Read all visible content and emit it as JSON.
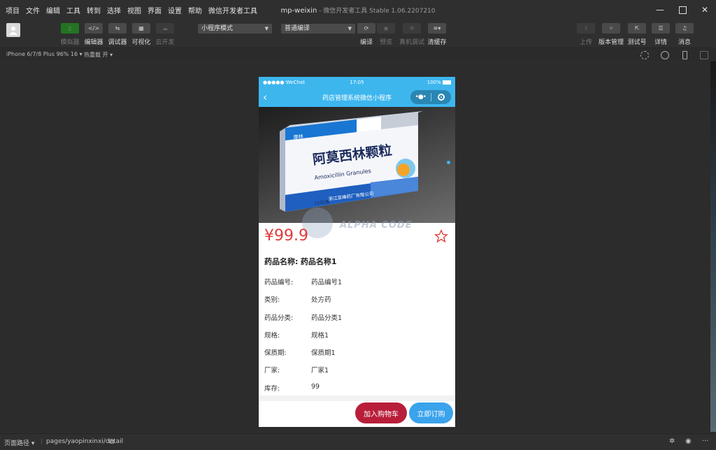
{
  "menubar": {
    "items": [
      "项目",
      "文件",
      "编辑",
      "工具",
      "转到",
      "选择",
      "视图",
      "界面",
      "设置",
      "帮助",
      "微信开发者工具"
    ],
    "title_project": "mp-weixin",
    "title_app": " - 微信开发者工具 Stable 1.06.2207210"
  },
  "toolbar": {
    "simulator_label": "模拟器",
    "editor_label": "编辑器",
    "debugger_label": "调试器",
    "visual_label": "可视化",
    "cloud_label": "云开发",
    "mode_select": "小程序模式",
    "compile_select": "普通编译",
    "compile_label": "编译",
    "preview_label": "预览",
    "remote_debug_label": "真机调试",
    "clear_cache_label": "清缓存",
    "upload_label": "上传",
    "version_label": "版本管理",
    "test_label": "测试号",
    "detail_label": "详情",
    "message_label": "消息"
  },
  "subbar": {
    "device": "iPhone 6/7/8 Plus 96% 16",
    "hot_reload": "热重载 开"
  },
  "phone": {
    "status_carrier": "●●●●● WeChat",
    "status_time": "17:05",
    "status_battery": "100%",
    "nav_title": "药店管理系统微信小程序",
    "price": "¥99.9",
    "watermark": "ALPHA CODE",
    "name_key": "药品名称:",
    "name_value": "药品名称1",
    "rows": [
      {
        "k": "药品编号:",
        "v": "药品编号1"
      },
      {
        "k": "类别:",
        "v": "处方药"
      },
      {
        "k": "药品分类:",
        "v": "药品分类1"
      },
      {
        "k": "规格:",
        "v": "规格1"
      },
      {
        "k": "保质期:",
        "v": "保质期1"
      },
      {
        "k": "厂家:",
        "v": "厂家1"
      },
      {
        "k": "库存:",
        "v": "99"
      }
    ],
    "add_cart": "加入购物车",
    "buy_now": "立即订购",
    "box_title": "阿莫西林颗粒",
    "box_subtitle": "Amoxicillin Granules",
    "box_brand": "摩林",
    "box_company": "浙江亚峰药厂有限公司",
    "box_count": "12包/盒"
  },
  "statusbar": {
    "page_path_label": "页面路径",
    "page_path": "pages/yaopinxinxi/detail"
  }
}
